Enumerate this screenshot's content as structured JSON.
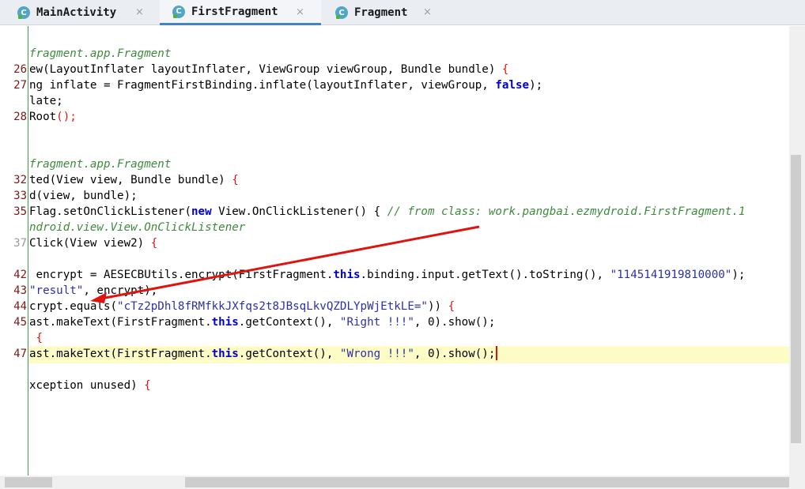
{
  "tabs": [
    {
      "label": "MainActivity",
      "icon": "class-icon"
    },
    {
      "label": "FirstFragment",
      "icon": "class-icon"
    },
    {
      "label": "Fragment",
      "icon": "class-icon"
    }
  ],
  "tab_close_glyph": "×",
  "class_icon_letter": "C",
  "line_numbers": {
    "l26": "26",
    "l27": "27",
    "l28": "28",
    "l32": "32",
    "l33": "33",
    "l35": "35",
    "l37": "37",
    "l42": "42",
    "l43": "43",
    "l44": "44",
    "l45": "45",
    "l47": "47"
  },
  "code": {
    "c1": "fragment.app.Fragment",
    "c2a": "ew(LayoutInflater layoutInflater, ViewGroup viewGroup, Bundle bundle) ",
    "c2b": "{",
    "c3a": "ng inflate = FragmentFirstBinding.inflate(layoutInflater, viewGroup, ",
    "c3b": "false",
    "c3c": ");",
    "c4": "late;",
    "c5a": "Root",
    "c5b": "();",
    "c6": "fragment.app.Fragment",
    "c7a": "ted(View view, Bundle bundle) ",
    "c7b": "{",
    "c8": "d(view, bundle);",
    "c9a": "Flag.setOnClickListener(",
    "c9b": "new",
    "c9c": " View.OnClickListener() { ",
    "c9d": "// from class: work.pangbai.ezmydroid.FirstFragment.1",
    "c10": "ndroid.view.View.OnClickListener",
    "c11a": "Click(View view2) ",
    "c11b": "{",
    "c12a": " encrypt = AESECBUtils.encrypt(FirstFragment.",
    "c12b": "this",
    "c12c": ".binding.input.getText().toString(), ",
    "c12d": "\"1145141919810000\"",
    "c12e": ");",
    "c13a": "\"result\"",
    "c13b": ", encrypt);",
    "c14a": "crypt.equals(",
    "c14b": "\"cTz2pDhl8fRMfkkJXfqs2t8JBsqLkvQZDLYpWjEtkLE=\"",
    "c14c": ")) ",
    "c14d": "{",
    "c15a": "ast.makeText(FirstFragment.",
    "c15b": "this",
    "c15c": ".getContext(), ",
    "c15d": "\"Right !!!\"",
    "c15e": ", 0).show();",
    "c16": " {",
    "c17a": "ast.makeText(FirstFragment.",
    "c17b": "this",
    "c17c": ".getContext(), ",
    "c17d": "\"Wrong !!!\"",
    "c17e": ", 0).show();",
    "c18a": "xception unused) ",
    "c18b": "{"
  },
  "colors": {
    "keyword": "#0000c8",
    "string": "#2b31a3",
    "comment": "#3e8a3e",
    "caret_line": "#fdfbc6",
    "annotation_arrow": "#e0140f",
    "active_tab_border": "#4083c9"
  }
}
